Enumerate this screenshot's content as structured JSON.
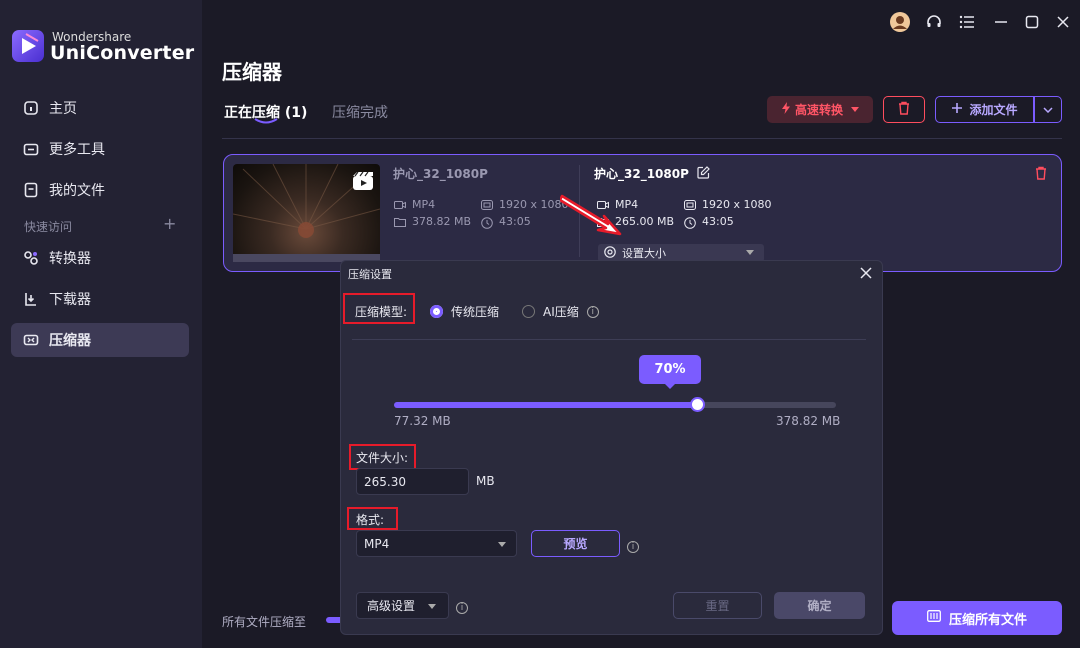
{
  "app": {
    "brand_small": "Wondershare",
    "brand_big": "UniConverter",
    "accent_color": "#7b5cff",
    "danger_color": "#ff4d5e"
  },
  "sidebar": {
    "items": [
      {
        "label": "主页",
        "icon": "home-icon"
      },
      {
        "label": "更多工具",
        "icon": "toolbox-icon"
      },
      {
        "label": "我的文件",
        "icon": "file-icon"
      }
    ],
    "quick_access_label": "快速访问",
    "quick_access_plus": "+",
    "quick_items": [
      {
        "label": "转换器",
        "icon": "converter-icon"
      },
      {
        "label": "下载器",
        "icon": "download-icon"
      },
      {
        "label": "压缩器",
        "icon": "compressor-icon",
        "active": true
      }
    ]
  },
  "header": {
    "page_title": "压缩器",
    "tab_active": "正在压缩 (1)",
    "tab_done": "压缩完成",
    "fast_convert_label": "高速转换",
    "add_file_label": "添加文件"
  },
  "card": {
    "source": {
      "name": "护心_32_1080P",
      "format": "MP4",
      "resolution": "1920 x 1080",
      "size": "378.82 MB",
      "duration": "43:05"
    },
    "output": {
      "name": "护心_32_1080P",
      "format": "MP4",
      "resolution": "1920 x 1080",
      "size": "265.00 MB",
      "duration": "43:05"
    },
    "setting_label": "设置大小"
  },
  "bottom": {
    "label": "所有文件压缩至",
    "compress_all_label": "压缩所有文件"
  },
  "dialog": {
    "title": "压缩设置",
    "mode_label": "压缩模型:",
    "mode_options": [
      "传统压缩",
      "AI压缩"
    ],
    "mode_selected": "传统压缩",
    "percent_label": "70%",
    "percent_value": 0.7,
    "range_min": "77.32 MB",
    "range_max": "378.82 MB",
    "size_label": "文件大小:",
    "size_value": "265.30",
    "size_unit": "MB",
    "format_label": "格式:",
    "format_value": "MP4",
    "preview_label": "预览",
    "advanced_label": "高级设置",
    "reset_label": "重置",
    "ok_label": "确定"
  }
}
